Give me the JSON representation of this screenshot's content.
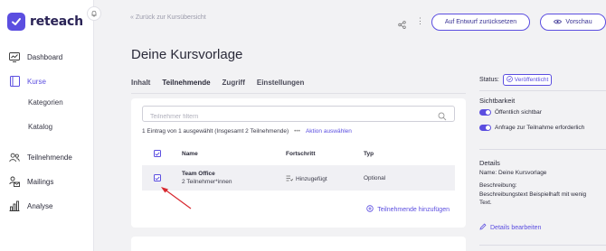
{
  "brand": {
    "name": "reteach",
    "accent": "#5b4ee0"
  },
  "sidebar": {
    "items": [
      {
        "label": "Dashboard",
        "icon": "dashboard-icon"
      },
      {
        "label": "Kurse",
        "icon": "courses-icon",
        "active": true
      },
      {
        "label": "Kategorien",
        "sub": true
      },
      {
        "label": "Katalog",
        "sub": true
      },
      {
        "label": "Teilnehmende",
        "icon": "participants-icon"
      },
      {
        "label": "Mailings",
        "icon": "mailings-icon"
      },
      {
        "label": "Analyse",
        "icon": "analytics-icon"
      }
    ]
  },
  "topbar": {
    "back_label": "Zurück zur Kursübersicht",
    "reset_label": "Auf Entwurf zurücksetzen",
    "preview_label": "Vorschau"
  },
  "page": {
    "title": "Deine Kursvorlage",
    "tabs": [
      "Inhalt",
      "Teilnehmende",
      "Zugriff",
      "Einstellungen"
    ]
  },
  "participants": {
    "filter_placeholder": "Teilnehmer filtern",
    "summary": "1 Eintrag von 1 ausgewählt (Insgesamt 2 Teilnehmende)",
    "more": "•••",
    "action_label": "Aktion auswählen",
    "columns": [
      "Name",
      "Fortschritt",
      "Typ"
    ],
    "rows": [
      {
        "name": "Team Office",
        "sub": "2 Teilnehmer*innen",
        "progress": "Hinzugefügt",
        "type": "Optional",
        "checked": true
      }
    ],
    "add_label": "Teilnehmende hinzufügen"
  },
  "sidepanel": {
    "status_label": "Status:",
    "status_value": "Veröffentlicht",
    "visibility_title": "Sichtbarkeit",
    "toggles": [
      "Öffentlich sichtbar",
      "Anfrage zur Teilnahme erforderlich"
    ],
    "details_title": "Details",
    "name_line": "Name: Deine Kursvorlage",
    "description_label": "Beschreibung:",
    "description_text": "Beschreibungstext Beispielhaft mit wenig Text.",
    "edit_label": "Details bearbeiten"
  }
}
